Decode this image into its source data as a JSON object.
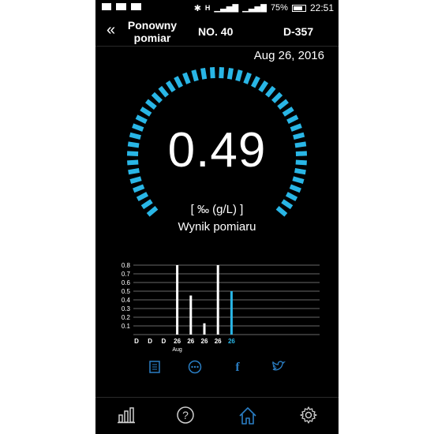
{
  "status_bar": {
    "battery": "75%",
    "time": "22:51",
    "network": "H"
  },
  "header": {
    "back_icon": "chevron-double-left-icon",
    "remeasure_label": "Ponowny pomiar",
    "number": "NO. 40",
    "device": "D-357"
  },
  "date": "Aug 26, 2016",
  "gauge": {
    "value": "0.49",
    "unit": "[ ‰ (g/L) ]",
    "label": "Wynik pomiaru",
    "accent": "#29b6e6"
  },
  "chart_data": {
    "type": "bar",
    "ylim": [
      0,
      0.8
    ],
    "yticks": [
      "0.1",
      "0.2",
      "0.3",
      "0.4",
      "0.5",
      "0.6",
      "0.7",
      "0.8"
    ],
    "categories": [
      "D",
      "D",
      "D",
      "26",
      "26",
      "26",
      "26",
      "26"
    ],
    "values": [
      0,
      0,
      0,
      0.8,
      0.45,
      0.13,
      0.8,
      0.5
    ],
    "highlight_index": 7,
    "month_label": "Aug",
    "bar_color": "#ffffff",
    "highlight_color": "#29b6e6"
  },
  "share": [
    {
      "name": "notes-icon"
    },
    {
      "name": "sms-icon"
    },
    {
      "name": "facebook-icon",
      "glyph": "f"
    },
    {
      "name": "twitter-icon"
    }
  ],
  "nav": [
    {
      "name": "history-chart-icon"
    },
    {
      "name": "help-icon",
      "glyph": "?"
    },
    {
      "name": "home-icon"
    },
    {
      "name": "settings-gear-icon"
    }
  ],
  "colors": {
    "background": "#000000",
    "text": "#ffffff",
    "accent": "#29b6e6",
    "share_icons": "#2a7ec4",
    "nav_icons": "#cfcfcf"
  }
}
